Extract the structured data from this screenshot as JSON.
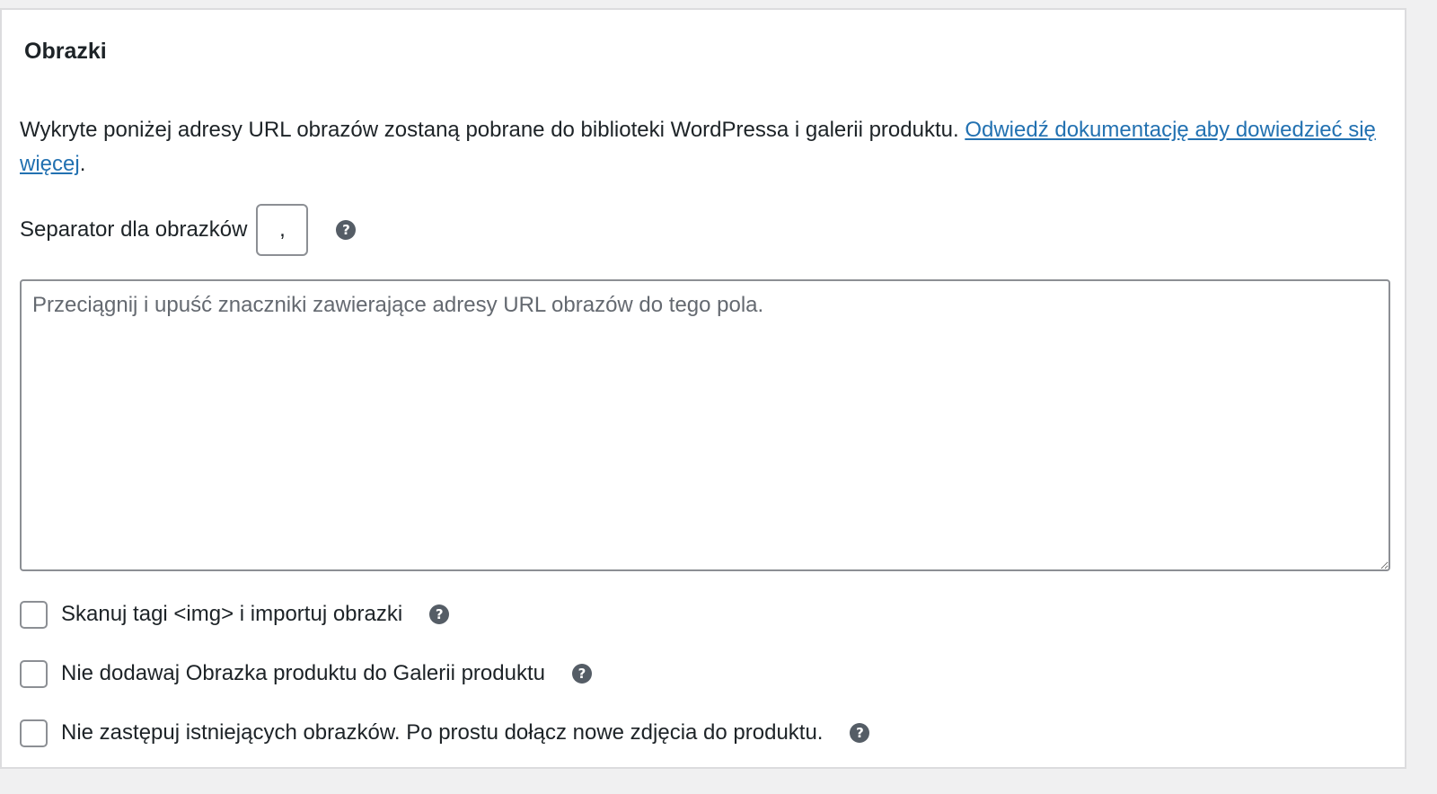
{
  "section": {
    "title": "Obrazki"
  },
  "description": {
    "text": "Wykryte poniżej adresy URL obrazów zostaną pobrane do biblioteki WordPressa i galerii produktu. ",
    "link_text": "Odwiedź dokumentację aby dowiedzieć się więcej",
    "suffix": "."
  },
  "separator": {
    "label": "Separator dla obrazków",
    "value": ",",
    "help_glyph": "?",
    "help_icon": "question-circle-icon"
  },
  "image_urls": {
    "placeholder": "Przeciągnij i upuść znaczniki zawierające adresy URL obrazów do tego pola.",
    "value": ""
  },
  "options": [
    {
      "label": "Skanuj tagi <img> i importuj obrazki",
      "checked": false,
      "help_glyph": "?"
    },
    {
      "label": "Nie dodawaj Obrazka produktu do Galerii produktu",
      "checked": false,
      "help_glyph": "?"
    },
    {
      "label": "Nie zastępuj istniejących obrazków. Po prostu dołącz nowe zdjęcia do produktu.",
      "checked": false,
      "help_glyph": "?"
    }
  ],
  "colors": {
    "link": "#2271b1",
    "help_icon_bg": "#555d66",
    "border": "#8c8f94",
    "text": "#1d2327"
  }
}
